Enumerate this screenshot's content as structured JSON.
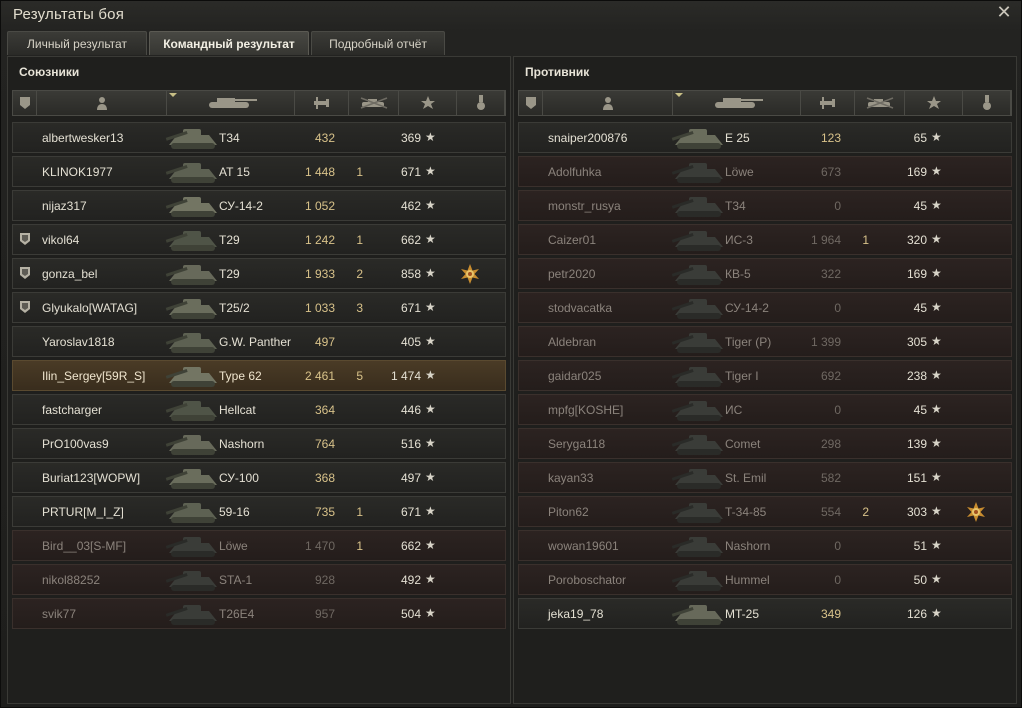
{
  "window": {
    "title": "Результаты боя",
    "close_icon": "close-icon"
  },
  "tabs": [
    {
      "label": "Личный результат",
      "active": false
    },
    {
      "label": "Командный результат",
      "active": true
    },
    {
      "label": "Подробный отчёт",
      "active": false
    }
  ],
  "columns": [
    "platoon-icon",
    "player-icon",
    "vehicle-icon",
    "damage-icon",
    "frags-icon",
    "xp-star-icon",
    "medal-icon"
  ],
  "colors": {
    "accent_gold": "#d8c28a",
    "self_row": "#4a3b26",
    "dead_row": "#2c2321"
  },
  "allies": {
    "title": "Союзники",
    "players": [
      {
        "name": "albertwesker13",
        "vehicle": "T34",
        "damage": "432",
        "kills": "",
        "xp": "369",
        "platoon": false,
        "medal": false,
        "state": "alive"
      },
      {
        "name": "KLINOK1977",
        "vehicle": "AT 15",
        "damage": "1 448",
        "kills": "1",
        "xp": "671",
        "platoon": false,
        "medal": false,
        "state": "alive"
      },
      {
        "name": "nijaz317",
        "vehicle": "СУ-14-2",
        "damage": "1 052",
        "kills": "",
        "xp": "462",
        "platoon": false,
        "medal": false,
        "state": "alive"
      },
      {
        "name": "vikol64",
        "vehicle": "T29",
        "damage": "1 242",
        "kills": "1",
        "xp": "662",
        "platoon": true,
        "medal": false,
        "state": "alive"
      },
      {
        "name": "gonza_bel",
        "vehicle": "T29",
        "damage": "1 933",
        "kills": "2",
        "xp": "858",
        "platoon": true,
        "medal": true,
        "state": "alive"
      },
      {
        "name": "Glyukalo[WATAG]",
        "vehicle": "T25/2",
        "damage": "1 033",
        "kills": "3",
        "xp": "671",
        "platoon": true,
        "medal": false,
        "state": "alive"
      },
      {
        "name": "Yaroslav1818",
        "vehicle": "G.W. Panther",
        "damage": "497",
        "kills": "",
        "xp": "405",
        "platoon": false,
        "medal": false,
        "state": "alive"
      },
      {
        "name": "Ilin_Sergey[59R_S]",
        "vehicle": "Type 62",
        "damage": "2 461",
        "kills": "5",
        "xp": "1 474",
        "platoon": false,
        "medal": false,
        "state": "self"
      },
      {
        "name": "fastcharger",
        "vehicle": "Hellcat",
        "damage": "364",
        "kills": "",
        "xp": "446",
        "platoon": false,
        "medal": false,
        "state": "alive"
      },
      {
        "name": "PrO100vas9",
        "vehicle": "Nashorn",
        "damage": "764",
        "kills": "",
        "xp": "516",
        "platoon": false,
        "medal": false,
        "state": "alive"
      },
      {
        "name": "Buriat123[WOPW]",
        "vehicle": "СУ-100",
        "damage": "368",
        "kills": "",
        "xp": "497",
        "platoon": false,
        "medal": false,
        "state": "alive"
      },
      {
        "name": "PRTUR[M_I_Z]",
        "vehicle": "59-16",
        "damage": "735",
        "kills": "1",
        "xp": "671",
        "platoon": false,
        "medal": false,
        "state": "alive"
      },
      {
        "name": "Bird__03[S-MF]",
        "vehicle": "Löwe",
        "damage": "1 470",
        "kills": "1",
        "xp": "662",
        "platoon": false,
        "medal": false,
        "state": "dead"
      },
      {
        "name": "nikol88252",
        "vehicle": "STA-1",
        "damage": "928",
        "kills": "",
        "xp": "492",
        "platoon": false,
        "medal": false,
        "state": "dead"
      },
      {
        "name": "svik77",
        "vehicle": "T26E4",
        "damage": "957",
        "kills": "",
        "xp": "504",
        "platoon": false,
        "medal": false,
        "state": "dead"
      }
    ]
  },
  "enemies": {
    "title": "Противник",
    "players": [
      {
        "name": "snaiper200876",
        "vehicle": "E 25",
        "damage": "123",
        "kills": "",
        "xp": "65",
        "platoon": false,
        "medal": false,
        "state": "alive"
      },
      {
        "name": "Adolfuhka",
        "vehicle": "Löwe",
        "damage": "673",
        "kills": "",
        "xp": "169",
        "platoon": false,
        "medal": false,
        "state": "dead"
      },
      {
        "name": "monstr_rusya",
        "vehicle": "T34",
        "damage": "0",
        "kills": "",
        "xp": "45",
        "platoon": false,
        "medal": false,
        "state": "dead"
      },
      {
        "name": "Caizer01",
        "vehicle": "ИС-3",
        "damage": "1 964",
        "kills": "1",
        "xp": "320",
        "platoon": false,
        "medal": false,
        "state": "dead"
      },
      {
        "name": "petr2020",
        "vehicle": "КВ-5",
        "damage": "322",
        "kills": "",
        "xp": "169",
        "platoon": false,
        "medal": false,
        "state": "dead"
      },
      {
        "name": "stodvacatka",
        "vehicle": "СУ-14-2",
        "damage": "0",
        "kills": "",
        "xp": "45",
        "platoon": false,
        "medal": false,
        "state": "dead"
      },
      {
        "name": "Aldebran",
        "vehicle": "Tiger (P)",
        "damage": "1 399",
        "kills": "",
        "xp": "305",
        "platoon": false,
        "medal": false,
        "state": "dead"
      },
      {
        "name": "gaidar025",
        "vehicle": "Tiger I",
        "damage": "692",
        "kills": "",
        "xp": "238",
        "platoon": false,
        "medal": false,
        "state": "dead"
      },
      {
        "name": "mpfg[KOSHE]",
        "vehicle": "ИС",
        "damage": "0",
        "kills": "",
        "xp": "45",
        "platoon": false,
        "medal": false,
        "state": "dead"
      },
      {
        "name": "Seryga118",
        "vehicle": "Comet",
        "damage": "298",
        "kills": "",
        "xp": "139",
        "platoon": false,
        "medal": false,
        "state": "dead"
      },
      {
        "name": "kayan33",
        "vehicle": "St. Emil",
        "damage": "582",
        "kills": "",
        "xp": "151",
        "platoon": false,
        "medal": false,
        "state": "dead"
      },
      {
        "name": "Piton62",
        "vehicle": "T-34-85",
        "damage": "554",
        "kills": "2",
        "xp": "303",
        "platoon": false,
        "medal": true,
        "state": "dead"
      },
      {
        "name": "wowan19601",
        "vehicle": "Nashorn",
        "damage": "0",
        "kills": "",
        "xp": "51",
        "platoon": false,
        "medal": false,
        "state": "dead"
      },
      {
        "name": "Poroboschator",
        "vehicle": "Hummel",
        "damage": "0",
        "kills": "",
        "xp": "50",
        "platoon": false,
        "medal": false,
        "state": "dead"
      },
      {
        "name": "jeka19_78",
        "vehicle": "MT-25",
        "damage": "349",
        "kills": "",
        "xp": "126",
        "platoon": false,
        "medal": false,
        "state": "alive"
      }
    ]
  }
}
